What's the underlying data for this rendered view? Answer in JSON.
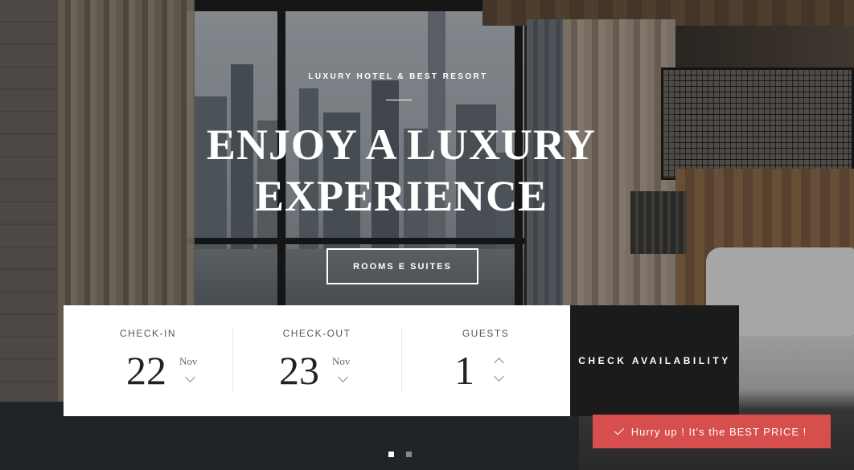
{
  "hero": {
    "eyebrow": "LUXURY HOTEL & BEST RESORT",
    "headline": "ENJOY A LUXURY EXPERIENCE",
    "cta_label": "ROOMS E SUITES"
  },
  "booking": {
    "checkin": {
      "label": "CHECK-IN",
      "day": "22",
      "month": "Nov"
    },
    "checkout": {
      "label": "CHECK-OUT",
      "day": "23",
      "month": "Nov"
    },
    "guests": {
      "label": "GUESTS",
      "value": "1"
    },
    "check_button": "CHECK AVAILABILITY"
  },
  "toast": {
    "text": "Hurry up ! It's the BEST PRICE !"
  },
  "slider": {
    "slides": 2,
    "active": 1
  },
  "colors": {
    "toast_bg": "#d74f4d",
    "button_bg": "#1b1b1b",
    "booking_bg": "#ffffff"
  }
}
